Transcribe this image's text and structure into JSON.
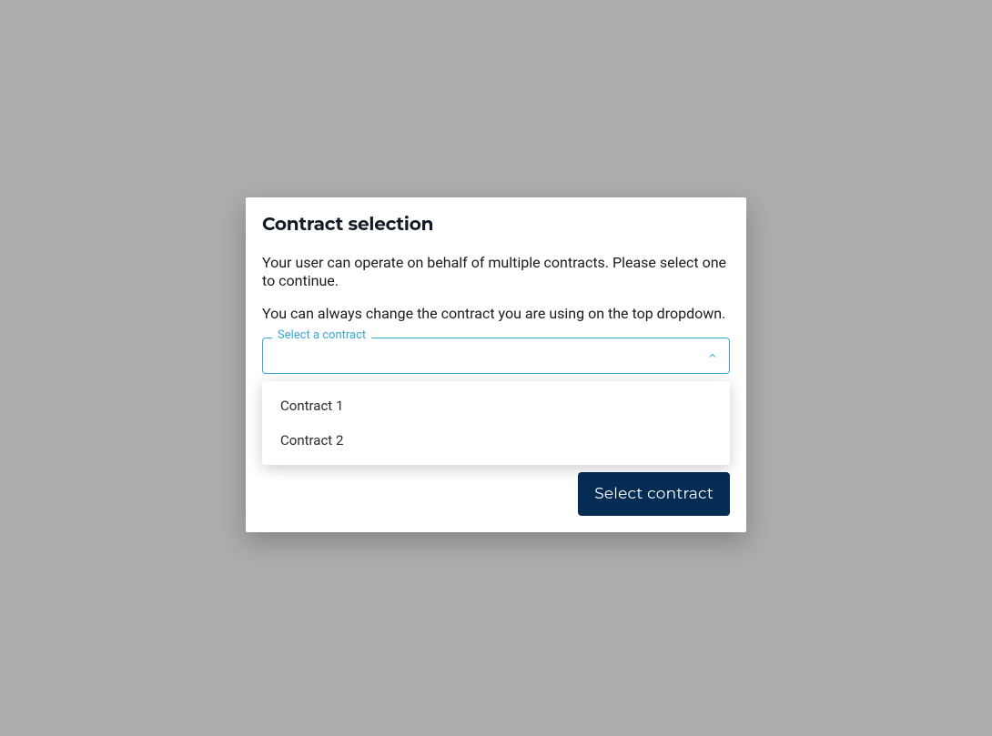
{
  "modal": {
    "title": "Contract selection",
    "description1": "Your user can operate on behalf of multiple contracts. Please select one to continue.",
    "description2": "You can always change the contract you are using on the top dropdown."
  },
  "select": {
    "label": "Select a contract",
    "value": "",
    "options": [
      "Contract 1",
      "Contract 2"
    ]
  },
  "actions": {
    "primary_label": "Select contract"
  }
}
